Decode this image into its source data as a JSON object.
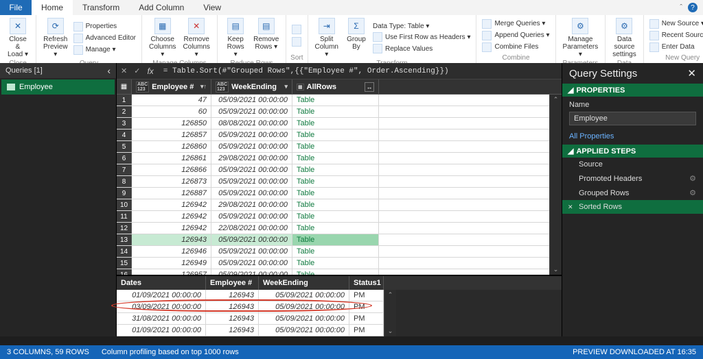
{
  "tabs": {
    "file": "File",
    "home": "Home",
    "transform": "Transform",
    "addcol": "Add Column",
    "view": "View"
  },
  "ribbon": {
    "close": "Close",
    "closeLoad": "Close &\nLoad ▾",
    "refresh": "Refresh\nPreview ▾",
    "props": "Properties",
    "adveditor": "Advanced Editor",
    "manage": "Manage ▾",
    "queryGroup": "Query",
    "chooseCols": "Choose\nColumns ▾",
    "removeCols": "Remove\nColumns ▾",
    "manageCols": "Manage Columns",
    "keepRows": "Keep\nRows ▾",
    "removeRows": "Remove\nRows ▾",
    "reduceRows": "Reduce Rows",
    "sort": "Sort",
    "split": "Split\nColumn ▾",
    "groupBy": "Group\nBy",
    "dataType": "Data Type: Table ▾",
    "firstRow": "Use First Row as Headers ▾",
    "replace": "Replace Values",
    "transformGroup": "Transform",
    "merge": "Merge Queries ▾",
    "append": "Append Queries ▾",
    "combineFiles": "Combine Files",
    "combineGroup": "Combine",
    "manageParams": "Manage\nParameters ▾",
    "paramsGroup": "Parameters",
    "dataSource": "Data source\nsettings",
    "dataSourcesGroup": "Data Sources",
    "newSource": "New Source ▾",
    "recentSources": "Recent Sources ▾",
    "enterData": "Enter Data",
    "newQueryGroup": "New Query"
  },
  "queriesPane": {
    "header": "Queries [1]",
    "item": "Employee"
  },
  "formula": "= Table.Sort(#\"Grouped Rows\",{{\"Employee #\", Order.Ascending}})",
  "columns": {
    "c1": "Employee #",
    "c2": "WeekEnding",
    "c3": "AllRows",
    "type": "ABC\n123"
  },
  "rows": [
    {
      "n": 1,
      "e": "47",
      "w": "05/09/2021 00:00:00",
      "a": "Table"
    },
    {
      "n": 2,
      "e": "60",
      "w": "05/09/2021 00:00:00",
      "a": "Table"
    },
    {
      "n": 3,
      "e": "126850",
      "w": "08/08/2021 00:00:00",
      "a": "Table"
    },
    {
      "n": 4,
      "e": "126857",
      "w": "05/09/2021 00:00:00",
      "a": "Table"
    },
    {
      "n": 5,
      "e": "126860",
      "w": "05/09/2021 00:00:00",
      "a": "Table"
    },
    {
      "n": 6,
      "e": "126861",
      "w": "29/08/2021 00:00:00",
      "a": "Table"
    },
    {
      "n": 7,
      "e": "126866",
      "w": "05/09/2021 00:00:00",
      "a": "Table"
    },
    {
      "n": 8,
      "e": "126873",
      "w": "05/09/2021 00:00:00",
      "a": "Table"
    },
    {
      "n": 9,
      "e": "126887",
      "w": "05/09/2021 00:00:00",
      "a": "Table"
    },
    {
      "n": 10,
      "e": "126942",
      "w": "29/08/2021 00:00:00",
      "a": "Table"
    },
    {
      "n": 11,
      "e": "126942",
      "w": "05/09/2021 00:00:00",
      "a": "Table"
    },
    {
      "n": 12,
      "e": "126942",
      "w": "22/08/2021 00:00:00",
      "a": "Table"
    },
    {
      "n": 13,
      "e": "126943",
      "w": "05/09/2021 00:00:00",
      "a": "Table",
      "sel": true
    },
    {
      "n": 14,
      "e": "126946",
      "w": "05/09/2021 00:00:00",
      "a": "Table"
    },
    {
      "n": 15,
      "e": "126949",
      "w": "05/09/2021 00:00:00",
      "a": "Table"
    },
    {
      "n": 16,
      "e": "126957",
      "w": "05/09/2021 00:00:00",
      "a": "Table"
    }
  ],
  "preview": {
    "cols": {
      "dates": "Dates",
      "emp": "Employee #",
      "week": "WeekEnding",
      "status": "Status1"
    },
    "rows": [
      {
        "d": "01/09/2021 00:00:00",
        "e": "126943",
        "w": "05/09/2021 00:00:00",
        "s": "PM"
      },
      {
        "d": "03/09/2021 00:00:00",
        "e": "126943",
        "w": "05/09/2021 00:00:00",
        "s": "PM"
      },
      {
        "d": "31/08/2021 00:00:00",
        "e": "126943",
        "w": "05/09/2021 00:00:00",
        "s": "PM"
      },
      {
        "d": "01/09/2021 00:00:00",
        "e": "126943",
        "w": "05/09/2021 00:00:00",
        "s": "PM"
      }
    ]
  },
  "settings": {
    "title": "Query Settings",
    "properties": "PROPERTIES",
    "nameLabel": "Name",
    "nameValue": "Employee",
    "allProps": "All Properties",
    "appliedSteps": "APPLIED STEPS",
    "steps": [
      "Source",
      "Promoted Headers",
      "Grouped Rows",
      "Sorted Rows"
    ]
  },
  "status": {
    "left1": "3 COLUMNS, 59 ROWS",
    "left2": "Column profiling based on top 1000 rows",
    "right": "PREVIEW DOWNLOADED AT 16:35"
  }
}
